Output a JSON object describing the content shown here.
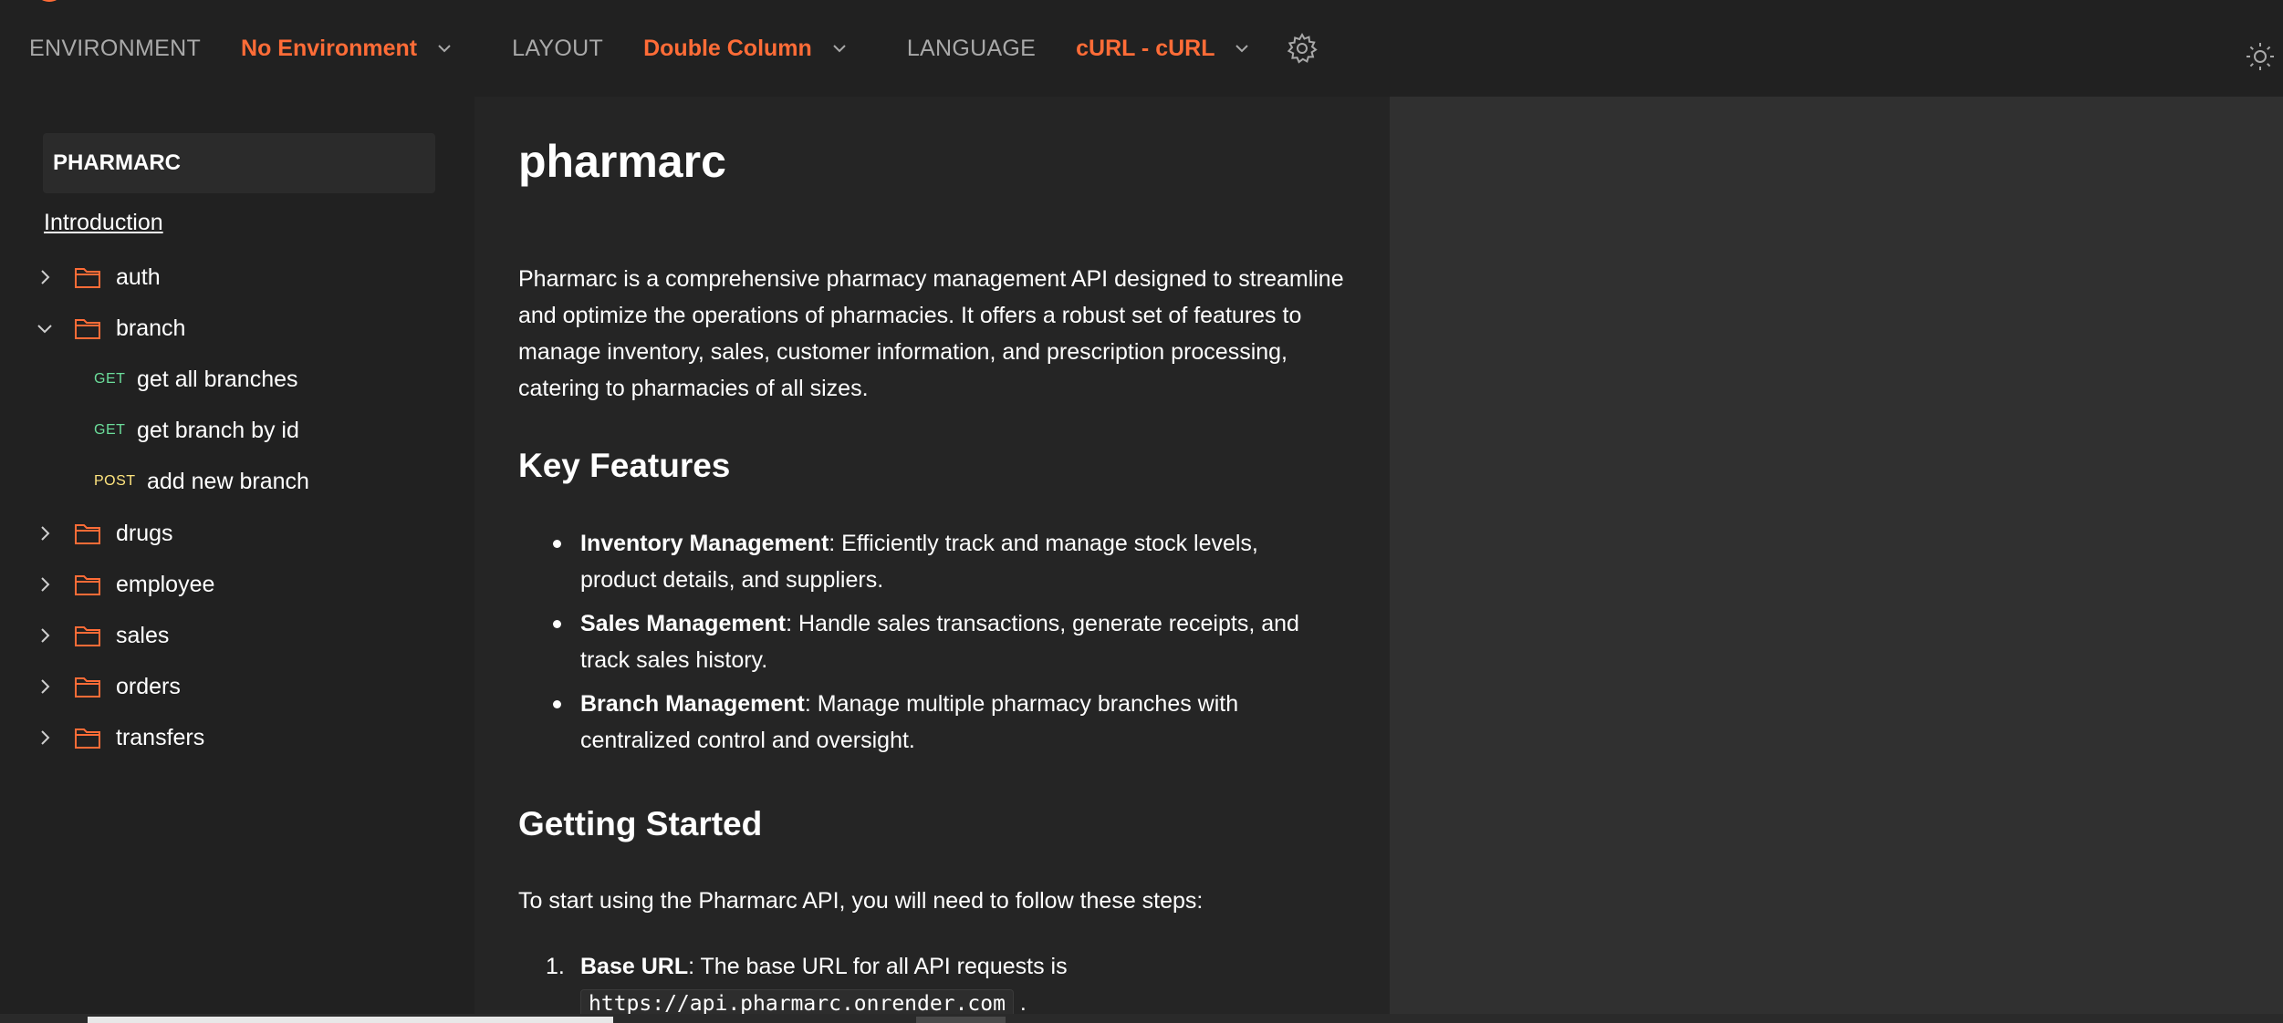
{
  "topbar": {
    "environment_label": "ENVIRONMENT",
    "environment_value": "No Environment",
    "layout_label": "LAYOUT",
    "layout_value": "Double Column",
    "language_label": "LANGUAGE",
    "language_value": "cURL - cURL"
  },
  "sidebar": {
    "collection_title": "PHARMARC",
    "intro_link": "Introduction",
    "folders": [
      {
        "label": "auth",
        "expanded": false
      },
      {
        "label": "branch",
        "expanded": true
      },
      {
        "label": "drugs",
        "expanded": false
      },
      {
        "label": "employee",
        "expanded": false
      },
      {
        "label": "sales",
        "expanded": false
      },
      {
        "label": "orders",
        "expanded": false
      },
      {
        "label": "transfers",
        "expanded": false
      }
    ],
    "branch_requests": [
      {
        "method": "GET",
        "label": "get all branches"
      },
      {
        "method": "GET",
        "label": "get branch by id"
      },
      {
        "method": "POST",
        "label": "add new branch"
      }
    ]
  },
  "doc": {
    "title": "pharmarc",
    "intro": "Pharmarc is a comprehensive pharmacy management API designed to streamline and optimize the operations of pharmacies. It offers a robust set of features to manage inventory, sales, customer information, and prescription processing, catering to pharmacies of all sizes.",
    "key_features_heading": "Key Features",
    "features": [
      {
        "title": "Inventory Management",
        "text": ": Efficiently track and manage stock levels, product details, and suppliers."
      },
      {
        "title": "Sales Management",
        "text": ": Handle sales transactions, generate receipts, and track sales history."
      },
      {
        "title": "Branch Management",
        "text": ": Manage multiple pharmacy branches with centralized control and oversight."
      }
    ],
    "getting_started_heading": "Getting Started",
    "getting_started_text": "To start using the Pharmarc API, you will need to follow these steps:",
    "steps": [
      {
        "num": "1.",
        "title": "Base URL",
        "text": ": The base URL for all API requests is",
        "code": "https://api.pharmarc.onrender.com",
        "suffix": "."
      }
    ]
  },
  "colors": {
    "accent": "#ff6c37",
    "get": "#6bdd9a",
    "post": "#ffe47e",
    "bg": "#212121",
    "right_pane": "#303030"
  }
}
